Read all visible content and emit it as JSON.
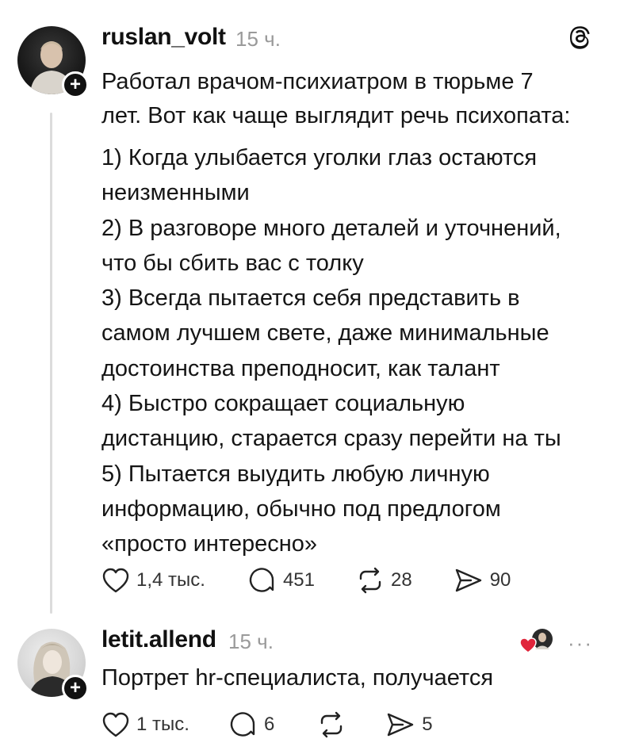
{
  "post1": {
    "username": "ruslan_volt",
    "time": "15 ч.",
    "intro": "Работал врачом-психиатром в тюрьме 7\nлет. Вот как чаще выглядит речь психопата:",
    "list": "1) Когда улыбается уголки глаз остаются\nнеизменными\n2) В разговоре много деталей и уточнений,\nчто бы сбить вас с толку\n3) Всегда пытается себя представить в\nсамом лучшем свете, даже минимальные\nдостоинства преподносит, как талант\n4) Быстро сокращает социальную\nдистанцию, старается сразу перейти на ты\n5) Пытается выудить любую личную\nинформацию, обычно под предлогом\n«просто интересно»",
    "likes": "1,4 тыс.",
    "comments": "451",
    "reposts": "28",
    "shares": "90"
  },
  "post2": {
    "username": "letit.allend",
    "time": "15 ч.",
    "text": "Портрет hr-специалиста, получается",
    "likes": "1 тыс.",
    "comments": "6",
    "shares": "5"
  },
  "icons": {
    "like": "heart-icon",
    "comment": "comment-icon",
    "repost": "repost-icon",
    "share": "share-icon",
    "app": "threads-logo-icon",
    "more": "more-icon"
  },
  "colors": {
    "heart": "#e0253b",
    "text": "#151515",
    "meta": "#9a9a9a"
  }
}
